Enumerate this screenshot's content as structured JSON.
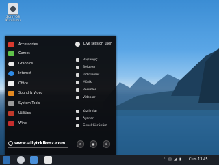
{
  "desktop": {
    "icon_label": "Zorin OS\nKurulumu"
  },
  "menu": {
    "categories": [
      {
        "label": "Accessories",
        "color": "#d93a2f"
      },
      {
        "label": "Games",
        "color": "#5fc24a"
      },
      {
        "label": "Graphics",
        "color": "#e8e8e8"
      },
      {
        "label": "Internet",
        "color": "#2e8ae6"
      },
      {
        "label": "Office",
        "color": "#f0f0f0"
      },
      {
        "label": "Sound & Video",
        "color": "#e58a22"
      },
      {
        "label": "System Tools",
        "color": "#9a9a9a"
      },
      {
        "label": "Utilities",
        "color": "#c0392b"
      },
      {
        "label": "Wine",
        "color": "#c52d2d"
      }
    ],
    "user": "Live session user",
    "places": [
      "Başlangıç",
      "Belgeler",
      "İndirilenler",
      "Müzik",
      "Resimler",
      "Videolar"
    ],
    "system": [
      "Yazılımlar",
      "Ayarlar",
      "Genel Görünüm"
    ],
    "search_text": "www.allytrklkmz.com"
  },
  "taskbar": {
    "time": "Cum 13:45"
  }
}
